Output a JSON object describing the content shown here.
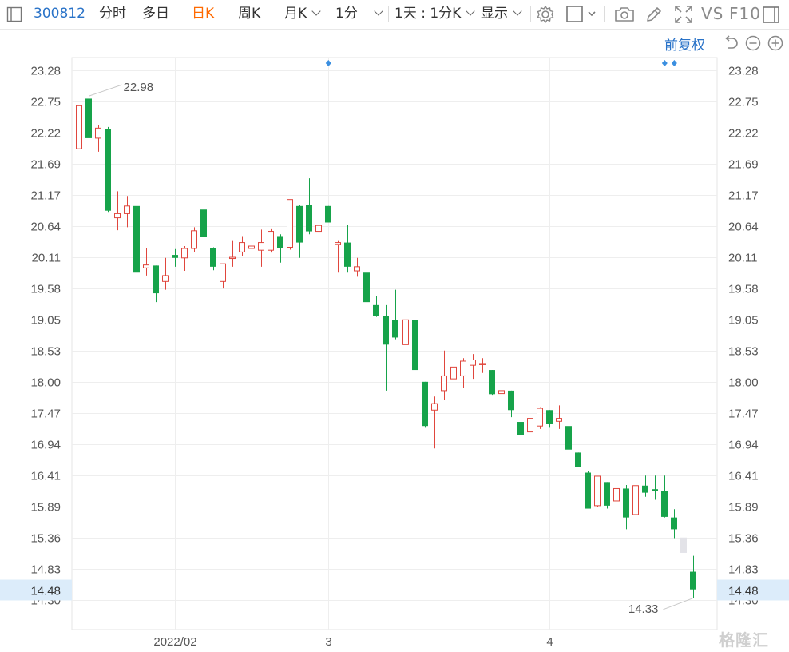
{
  "toolbar": {
    "code": "300812",
    "tabs": [
      "分时",
      "多日",
      "日K",
      "周K",
      "月K",
      "1分"
    ],
    "active_tab": "日K",
    "period_selector": "1天 : 1分K",
    "display_label": "显示",
    "vs_label": "VS",
    "f10_label": "F10"
  },
  "adjust_label": "前复权",
  "current_price": "14.48",
  "watermark": "格隆汇",
  "colors": {
    "up": "#e0463d",
    "down": "#16a34a",
    "accent": "#2a73c8",
    "active_tab": "#ff6a00",
    "price_line": "#e8a040",
    "price_badge": "#dcecfa",
    "grid": "#eeeeee"
  },
  "icons": [
    "sidebar-toggle-icon",
    "settings-icon",
    "square-icon",
    "camera-icon",
    "pen-icon",
    "fullscreen-icon",
    "window-icon",
    "undo-icon",
    "zoom-out-icon",
    "zoom-in-icon"
  ],
  "chart_data": {
    "type": "candlestick",
    "ylim": [
      14.3,
      23.4
    ],
    "y_ticks": [
      "23.28",
      "22.75",
      "22.22",
      "21.69",
      "21.17",
      "20.64",
      "20.11",
      "19.58",
      "19.05",
      "18.53",
      "18.00",
      "17.47",
      "16.94",
      "16.41",
      "15.89",
      "15.36",
      "14.83",
      "14.30"
    ],
    "x_labels": [
      "2022/02",
      "3",
      "4"
    ],
    "x_label_index": [
      10,
      26,
      49
    ],
    "max_label": "22.98",
    "min_label": "14.33",
    "markers_index": [
      26,
      61,
      62
    ],
    "candles": [
      {
        "o": 21.95,
        "h": 22.68,
        "l": 21.95,
        "c": 22.68
      },
      {
        "o": 22.8,
        "h": 22.98,
        "l": 21.96,
        "c": 22.13
      },
      {
        "o": 22.13,
        "h": 22.35,
        "l": 21.9,
        "c": 22.3
      },
      {
        "o": 22.28,
        "h": 22.32,
        "l": 20.88,
        "c": 20.9
      },
      {
        "o": 20.78,
        "h": 21.23,
        "l": 20.57,
        "c": 20.85
      },
      {
        "o": 20.85,
        "h": 21.15,
        "l": 20.62,
        "c": 20.98
      },
      {
        "o": 20.98,
        "h": 21.08,
        "l": 19.85,
        "c": 19.85
      },
      {
        "o": 19.93,
        "h": 20.26,
        "l": 19.8,
        "c": 19.98
      },
      {
        "o": 19.97,
        "h": 19.97,
        "l": 19.35,
        "c": 19.5
      },
      {
        "o": 19.7,
        "h": 20.1,
        "l": 19.56,
        "c": 19.8
      },
      {
        "o": 20.15,
        "h": 20.25,
        "l": 19.95,
        "c": 20.1
      },
      {
        "o": 20.1,
        "h": 20.3,
        "l": 19.88,
        "c": 20.26
      },
      {
        "o": 20.26,
        "h": 20.62,
        "l": 20.2,
        "c": 20.56
      },
      {
        "o": 20.92,
        "h": 21.0,
        "l": 20.35,
        "c": 20.46
      },
      {
        "o": 20.26,
        "h": 20.28,
        "l": 19.89,
        "c": 19.95
      },
      {
        "o": 19.7,
        "h": 20.0,
        "l": 19.58,
        "c": 20.0
      },
      {
        "o": 20.11,
        "h": 20.4,
        "l": 19.95,
        "c": 20.11
      },
      {
        "o": 20.2,
        "h": 20.47,
        "l": 20.13,
        "c": 20.36
      },
      {
        "o": 20.26,
        "h": 20.6,
        "l": 20.15,
        "c": 20.3
      },
      {
        "o": 20.23,
        "h": 20.58,
        "l": 19.95,
        "c": 20.36
      },
      {
        "o": 20.23,
        "h": 20.6,
        "l": 20.19,
        "c": 20.55
      },
      {
        "o": 20.47,
        "h": 20.5,
        "l": 20.02,
        "c": 20.26
      },
      {
        "o": 20.28,
        "h": 21.09,
        "l": 20.24,
        "c": 21.09
      },
      {
        "o": 20.98,
        "h": 21.0,
        "l": 20.1,
        "c": 20.36
      },
      {
        "o": 21.0,
        "h": 21.45,
        "l": 20.5,
        "c": 20.55
      },
      {
        "o": 20.55,
        "h": 20.7,
        "l": 20.15,
        "c": 20.65
      },
      {
        "o": 20.98,
        "h": 20.98,
        "l": 20.7,
        "c": 20.7
      },
      {
        "o": 20.33,
        "h": 20.4,
        "l": 19.85,
        "c": 20.36
      },
      {
        "o": 20.36,
        "h": 20.66,
        "l": 19.85,
        "c": 19.95
      },
      {
        "o": 19.88,
        "h": 20.1,
        "l": 19.78,
        "c": 19.95
      },
      {
        "o": 19.85,
        "h": 19.85,
        "l": 19.3,
        "c": 19.35
      },
      {
        "o": 19.3,
        "h": 19.45,
        "l": 19.1,
        "c": 19.12
      },
      {
        "o": 19.12,
        "h": 19.3,
        "l": 17.85,
        "c": 18.63
      },
      {
        "o": 19.05,
        "h": 19.56,
        "l": 18.72,
        "c": 18.75
      },
      {
        "o": 18.63,
        "h": 19.1,
        "l": 18.58,
        "c": 19.05
      },
      {
        "o": 19.05,
        "h": 19.05,
        "l": 18.2,
        "c": 18.2
      },
      {
        "o": 18.0,
        "h": 18.0,
        "l": 17.22,
        "c": 17.25
      },
      {
        "o": 17.52,
        "h": 17.75,
        "l": 16.87,
        "c": 17.63
      },
      {
        "o": 17.85,
        "h": 18.53,
        "l": 17.7,
        "c": 18.1
      },
      {
        "o": 18.05,
        "h": 18.4,
        "l": 17.8,
        "c": 18.25
      },
      {
        "o": 18.1,
        "h": 18.4,
        "l": 17.9,
        "c": 18.35
      },
      {
        "o": 18.28,
        "h": 18.47,
        "l": 18.05,
        "c": 18.37
      },
      {
        "o": 18.31,
        "h": 18.4,
        "l": 18.15,
        "c": 18.31
      },
      {
        "o": 18.2,
        "h": 18.2,
        "l": 17.78,
        "c": 17.79
      },
      {
        "o": 17.8,
        "h": 17.88,
        "l": 17.73,
        "c": 17.85
      },
      {
        "o": 17.85,
        "h": 17.85,
        "l": 17.4,
        "c": 17.52
      },
      {
        "o": 17.32,
        "h": 17.45,
        "l": 17.05,
        "c": 17.1
      },
      {
        "o": 17.15,
        "h": 17.38,
        "l": 17.15,
        "c": 17.38
      },
      {
        "o": 17.25,
        "h": 17.57,
        "l": 17.2,
        "c": 17.55
      },
      {
        "o": 17.52,
        "h": 17.52,
        "l": 17.22,
        "c": 17.28
      },
      {
        "o": 17.33,
        "h": 17.6,
        "l": 17.2,
        "c": 17.38
      },
      {
        "o": 17.25,
        "h": 17.25,
        "l": 16.8,
        "c": 16.85
      },
      {
        "o": 16.8,
        "h": 16.8,
        "l": 16.55,
        "c": 16.56
      },
      {
        "o": 16.46,
        "h": 16.48,
        "l": 15.85,
        "c": 15.85
      },
      {
        "o": 15.9,
        "h": 16.4,
        "l": 15.88,
        "c": 16.4
      },
      {
        "o": 16.3,
        "h": 16.3,
        "l": 15.85,
        "c": 15.9
      },
      {
        "o": 15.98,
        "h": 16.25,
        "l": 15.9,
        "c": 16.19
      },
      {
        "o": 16.19,
        "h": 16.25,
        "l": 15.5,
        "c": 15.7
      },
      {
        "o": 15.75,
        "h": 16.4,
        "l": 15.55,
        "c": 16.24
      },
      {
        "o": 16.24,
        "h": 16.41,
        "l": 16.05,
        "c": 16.12
      },
      {
        "o": 16.18,
        "h": 16.41,
        "l": 16.0,
        "c": 16.15
      },
      {
        "o": 16.15,
        "h": 16.41,
        "l": 15.7,
        "c": 15.71
      },
      {
        "o": 15.7,
        "h": 15.84,
        "l": 15.35,
        "c": 15.5
      },
      {
        "o": 15.36,
        "h": 15.36,
        "l": 15.1,
        "c": 15.1
      },
      {
        "o": 14.78,
        "h": 15.05,
        "l": 14.33,
        "c": 14.48
      }
    ],
    "special_colors": {
      "63": "#e3e3e8"
    }
  }
}
